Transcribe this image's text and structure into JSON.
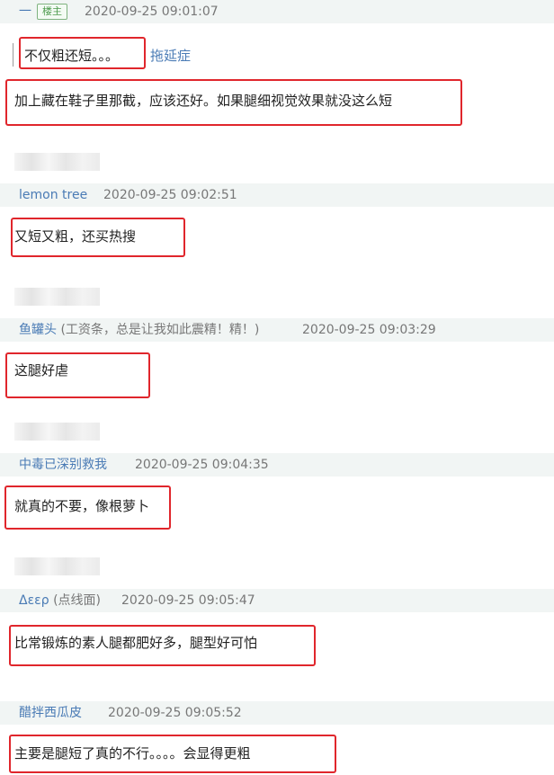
{
  "replies": [
    {
      "name": "一",
      "badge": "楼主",
      "time": "2020-09-25 09:01:07",
      "quote": "不仅粗还短。。。",
      "quote_link": "拖延症",
      "text": "加上藏在鞋子里那截，应该还好。如果腿细视觉效果就没这么短"
    },
    {
      "name": "lemon tree",
      "time": "2020-09-25 09:02:51",
      "text": "又短又粗，还买热搜"
    },
    {
      "name": "鱼罐头",
      "sub": "(工资条，总是让我如此震精！精！)",
      "time": "2020-09-25 09:03:29",
      "text": "这腿好虐"
    },
    {
      "name": "中毒已深别救我",
      "time": "2020-09-25 09:04:35",
      "text": "就真的不要，像根萝卜"
    },
    {
      "name": "Δεερ",
      "sub": "(点线面)",
      "time": "2020-09-25 09:05:47",
      "text": "比常锻炼的素人腿都肥好多，腿型好可怕"
    },
    {
      "name": "醋拌西瓜皮",
      "time": "2020-09-25 09:05:52",
      "text": "主要是腿短了真的不行。。。。会显得更粗"
    }
  ]
}
